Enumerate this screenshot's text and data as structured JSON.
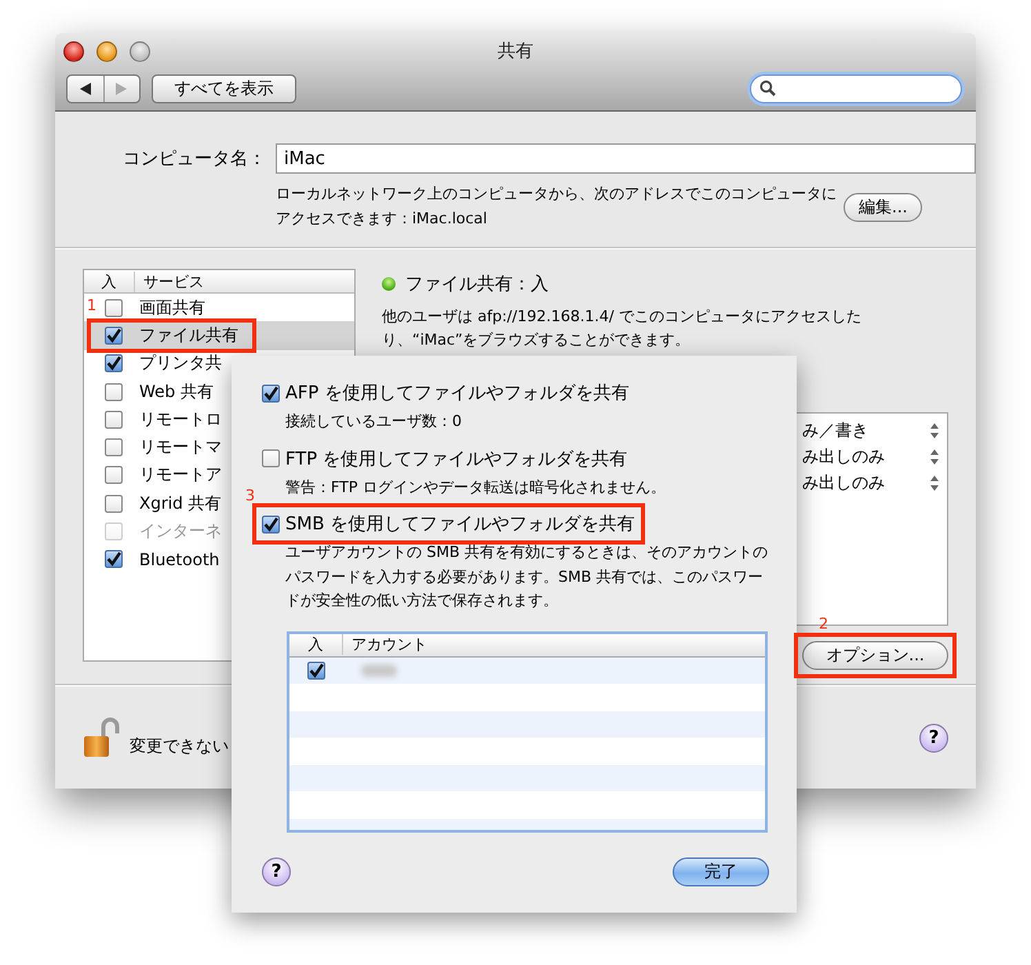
{
  "window": {
    "title": "共有"
  },
  "toolbar": {
    "show_all": "すべてを表示"
  },
  "computer_name": {
    "label": "コンピュータ名：",
    "value": "iMac",
    "description_lines": [
      "ローカルネットワーク上のコンピュータから、次のアドレスでこのコンピュータに",
      "アクセスできます：iMac.local"
    ],
    "edit_button": "編集..."
  },
  "services": {
    "columns": [
      "入",
      "サービス"
    ],
    "items": [
      {
        "name": "画面共有",
        "checked": false,
        "selected": false,
        "disabled": false
      },
      {
        "name": "ファイル共有",
        "checked": true,
        "selected": true,
        "disabled": false,
        "callout": "1"
      },
      {
        "name": "プリンタ共",
        "checked": true,
        "selected": false,
        "disabled": false
      },
      {
        "name": "Web 共有",
        "checked": false,
        "selected": false,
        "disabled": false
      },
      {
        "name": "リモートロ",
        "checked": false,
        "selected": false,
        "disabled": false
      },
      {
        "name": "リモートマ",
        "checked": false,
        "selected": false,
        "disabled": false
      },
      {
        "name": "リモートア",
        "checked": false,
        "selected": false,
        "disabled": false
      },
      {
        "name": "Xgrid 共有",
        "checked": false,
        "selected": false,
        "disabled": false
      },
      {
        "name": "インターネ",
        "checked": false,
        "selected": false,
        "disabled": true
      },
      {
        "name": "Bluetooth",
        "checked": true,
        "selected": false,
        "disabled": false
      }
    ]
  },
  "status": {
    "label": "ファイル共有：入",
    "on": true,
    "description_lines": [
      "他のユーザは afp://192.168.1.4/ でこのコンピュータにアクセスした",
      "り、“iMac”をブラウズすることができます。"
    ]
  },
  "permissions": [
    "み／書き",
    "み出しのみ",
    "み出しのみ"
  ],
  "options_button": {
    "label": "オプション...",
    "callout": "2"
  },
  "lock_text": "変更できない",
  "help_button": "?",
  "sheet": {
    "options": [
      {
        "label": "AFP を使用してファイルやフォルダを共有",
        "checked": true,
        "note_lines": [
          "接続しているユーザ数：0"
        ]
      },
      {
        "label": "FTP を使用してファイルやフォルダを共有",
        "checked": false,
        "note_lines": [
          "警告：FTP ログインやデータ転送は暗号化されません。"
        ]
      },
      {
        "label": "SMB を使用してファイルやフォルダを共有",
        "checked": true,
        "callout": "3",
        "note_lines": [
          "ユーザアカウントの SMB 共有を有効にするときは、そのアカウントの",
          "パスワードを入力する必要があります。SMB 共有では、このパスワー",
          "ドが安全性の低い方法で保存されます。"
        ]
      }
    ],
    "accounts": {
      "columns": [
        "入",
        "アカウント"
      ],
      "rows": [
        {
          "checked": true
        }
      ]
    },
    "help_button": "?",
    "done_button": "完了"
  }
}
